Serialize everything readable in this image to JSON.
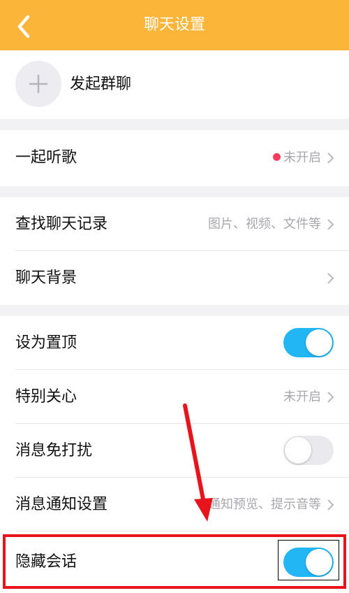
{
  "header": {
    "title": "聊天设置",
    "back_icon": "chevron-left-icon",
    "background": "#fbb539"
  },
  "group": {
    "label": "发起群聊",
    "icon": "plus-icon"
  },
  "music": {
    "label": "一起听歌",
    "value": "未开启",
    "indicator_color": "#ff3b5c"
  },
  "history": {
    "search_label": "查找聊天记录",
    "search_value": "图片、视频、文件等",
    "background_label": "聊天背景"
  },
  "settings": {
    "pin_label": "设为置顶",
    "pin_on": true,
    "special_label": "特别关心",
    "special_value": "未开启",
    "dnd_label": "消息免打扰",
    "dnd_on": false,
    "notify_label": "消息通知设置",
    "notify_value": "通知预览、提示音等",
    "hide_label": "隐藏会话",
    "hide_on": true
  },
  "colors": {
    "toggle_on": "#22b6f4",
    "toggle_off": "#e9e9ee",
    "annotation": "#e8141c"
  }
}
